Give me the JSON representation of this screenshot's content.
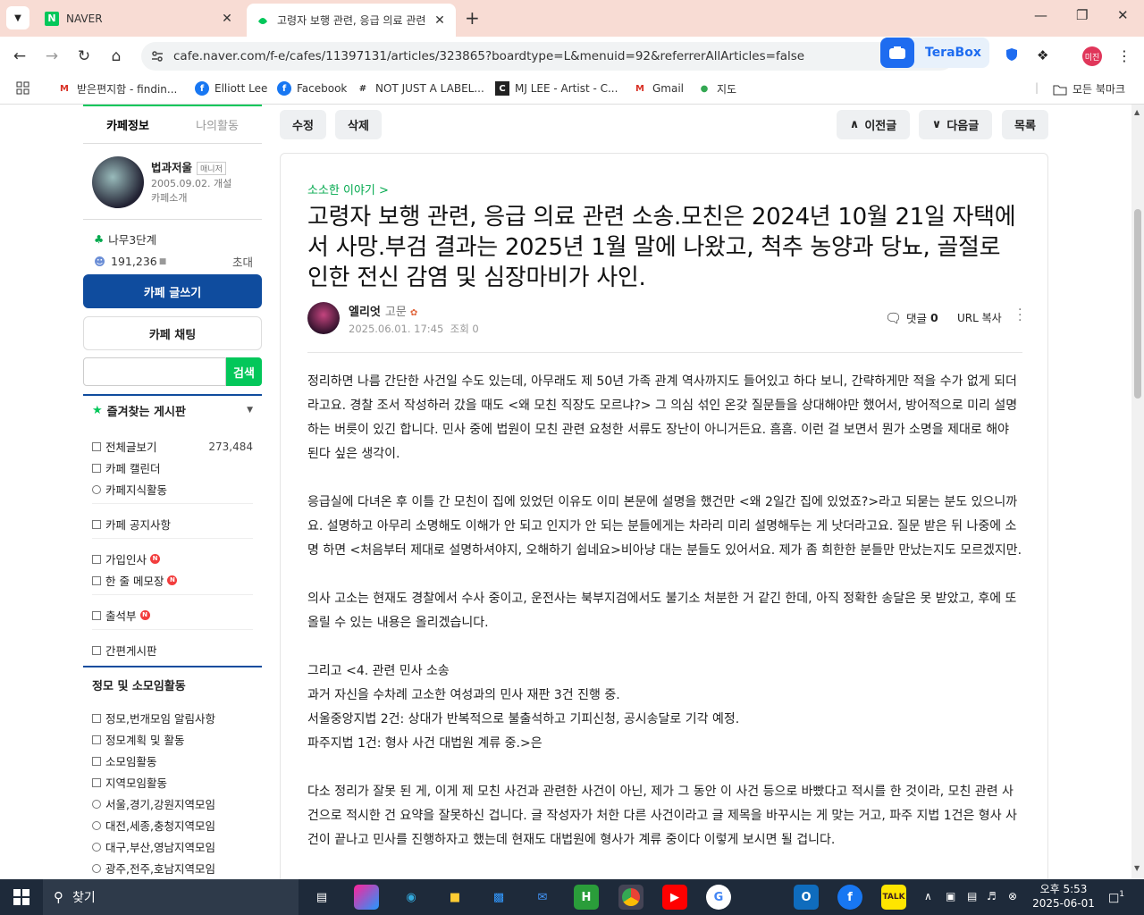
{
  "browser": {
    "tabs": [
      {
        "title": "NAVER"
      },
      {
        "title": "고령자 보행 관련, 응급 의료 관련"
      }
    ],
    "url": "cafe.naver.com/f-e/cafes/11397131/articles/323865?boardtype=L&menuid=92&referrerAllArticles=false",
    "terabox_label": "TeraBox",
    "profile_label": "미진",
    "bookmarks": [
      {
        "label": "받은편지함 - findin...",
        "icon": "gmail-icon"
      },
      {
        "label": "Elliott Lee",
        "icon": "facebook-icon"
      },
      {
        "label": "Facebook",
        "icon": "facebook-icon"
      },
      {
        "label": "NOT JUST A LABEL...",
        "icon": "njal-icon"
      },
      {
        "label": "MJ LEE - Artist - C...",
        "icon": "cv-icon"
      },
      {
        "label": "Gmail",
        "icon": "gmail-icon"
      },
      {
        "label": "지도",
        "icon": "map-pin-icon"
      }
    ],
    "all_bookmarks": "모든 북마크"
  },
  "sidebar": {
    "tabs": [
      "카페정보",
      "나의활동"
    ],
    "manager": "법과저울",
    "manager_badge": "매니저",
    "founded": "2005.09.02. 개설",
    "intro": "카페소개",
    "rank": "나무3단계",
    "members": "191,236",
    "invite": "초대",
    "write_btn": "카페 글쓰기",
    "chat_btn": "카페 채팅",
    "search_btn": "검색",
    "fav_head": "즐겨찾는 게시판",
    "items": [
      {
        "label": "전체글보기",
        "count": "273,484"
      },
      {
        "label": "카페 캘린더"
      },
      {
        "label": "카페지식활동"
      },
      {
        "label": "카페 공지사항"
      },
      {
        "label": "가입인사",
        "new": "N"
      },
      {
        "label": "한 줄 메모장",
        "new": "N"
      },
      {
        "label": "출석부",
        "new": "N"
      },
      {
        "label": "간편게시판"
      }
    ],
    "group_head": "정모 및 소모임활동",
    "group_items": [
      {
        "label": "정모,번개모임 알림사항"
      },
      {
        "label": "정모계획 및 활동"
      },
      {
        "label": "소모임활동"
      },
      {
        "label": "지역모임활동"
      },
      {
        "label": "서울,경기,강원지역모임"
      },
      {
        "label": "대전,세종,충청지역모임"
      },
      {
        "label": "대구,부산,영남지역모임"
      },
      {
        "label": "광주,전주,호남지역모임"
      }
    ]
  },
  "toolbar": {
    "edit": "수정",
    "delete": "삭제",
    "prev": "이전글",
    "next": "다음글",
    "list": "목록"
  },
  "article": {
    "board": "소소한 이야기 >",
    "title": "고령자 보행 관련, 응급 의료 관련 소송.모친은 2024년 10월 21일 자택에서 사망.부검 결과는 2025년 1월 말에 나왔고, 척추 농양과 당뇨, 골절로 인한 전신 감염 및 심장마비가 사인.",
    "author": "엘리엇",
    "grade": "고문",
    "date": "2025.06.01. 17:45",
    "views": "조회 0",
    "comments_label": "댓글",
    "comments_count": "0",
    "url_copy": "URL 복사",
    "paragraphs": [
      [
        "정리하면 나름 간단한 사건일 수도 있는데, 아무래도 제 50년 가족 관계 역사까지도 들어있고 하다 보니, 간략하게만 적을 수가 없게 되더라고요. 경찰 조서 작성하러 갔을 때도 <왜 모친 직장도 모르냐?> 그 의심 섞인 온갖 질문들을 상대해야만 했어서, 방어적으로 미리 설명하는 버릇이 있긴 합니다. 민사 중에 법원이 모친 관련 요청한 서류도 장난이 아니거든요. 흠흠. 이런 걸 보면서 뭔가 소명을 제대로 해야 된다 싶은 생각이."
      ],
      [
        "응급실에 다녀온 후 이틀 간 모친이 집에 있었던 이유도 이미 본문에 설명을 했건만 <왜 2일간 집에 있었죠?>라고 되묻는 분도 있으니까요. 설명하고 아무리 소명해도 이해가 안 되고 인지가 안 되는 분들에게는 차라리 미리 설명해두는 게 낫더라고요. 질문 받은 뒤 나중에 소명 하면 <처음부터 제대로 설명하셔야지, 오해하기 쉽네요>비아냥 대는 분들도 있어서요. 제가 좀 희한한 분들만 만났는지도 모르겠지만."
      ],
      [
        "의사 고소는 현재도 경찰에서 수사 중이고, 운전사는 북부지검에서도 불기소 처분한 거 같긴 한데, 아직 정확한 송달은 못 받았고, 후에 또 올릴 수 있는 내용은 올리겠습니다."
      ],
      [
        "그리고 <4. 관련 민사 소송",
        "과거 자신을 수차례 고소한 여성과의 민사 재판 3건 진행 중.",
        "서울중앙지법 2건: 상대가 반복적으로 불출석하고 기피신청, 공시송달로 기각 예정.",
        "파주지법 1건: 형사 사건 대법원 계류 중.>은"
      ],
      [
        "다소 정리가 잘못 된 게, 이게 제 모친 사건과 관련한 사건이 아닌, 제가 그 동안 이 사건 등으로 바빴다고 적시를 한 것이라, 모친 관련 사건으로 적시한 건 요약을 잘못하신 겁니다. 글 작성자가 처한 다른 사건이라고 글 제목을 바꾸시는 게 맞는 거고, 파주 지법 1건은 형사 사건이 끝나고 민사를 진행하자고 했는데 현재도 대법원에 형사가 계류 중이다 이렇게 보시면 될 겁니다."
      ]
    ]
  },
  "taskbar": {
    "search": "찾기",
    "time": "오후 5:53",
    "date": "2025-06-01",
    "notif_count": "1"
  }
}
